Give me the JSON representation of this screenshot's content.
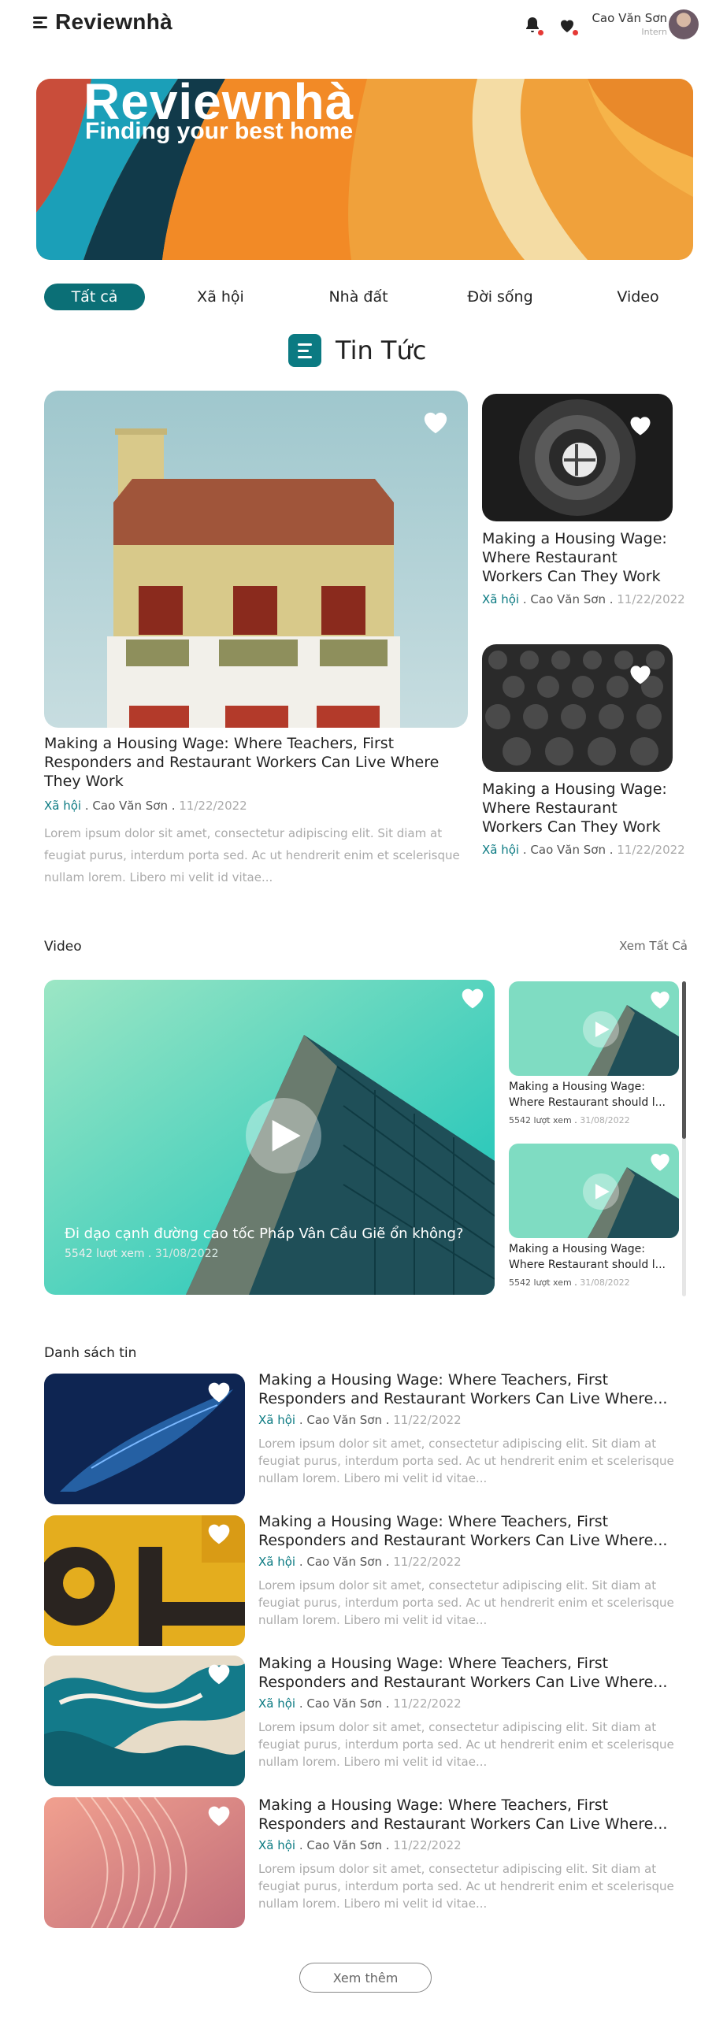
{
  "header": {
    "logo": "Reviewnhà",
    "user_name": "Cao Văn Sơn",
    "user_role": "Intern"
  },
  "banner": {
    "title": "Reviewnhà",
    "subtitle": "Finding your best home"
  },
  "tabs": [
    {
      "label": "Tất cả"
    },
    {
      "label": "Xã hội"
    },
    {
      "label": "Nhà đất"
    },
    {
      "label": "Đời sống"
    },
    {
      "label": "Video"
    }
  ],
  "news_section": {
    "title": "Tin Tức",
    "featured": {
      "title": "Making a Housing Wage: Where Teachers, First Responders and Restaurant Workers Can Live Where They Work",
      "category": "Xã hội",
      "author": "Cao Văn Sơn",
      "date": "11/22/2022",
      "excerpt": "Lorem ipsum dolor sit amet, consectetur adipiscing elit. Sit diam at feugiat purus, interdum porta sed. Ac ut hendrerit enim et scelerisque nullam lorem. Libero mi velit id vitae..."
    },
    "side": [
      {
        "title": "Making a Housing Wage: Where Restaurant Workers Can They Work",
        "category": "Xã hội",
        "author": "Cao Văn Sơn",
        "date": "11/22/2022"
      },
      {
        "title": "Making a Housing Wage: Where Restaurant Workers Can They Work",
        "category": "Xã hội",
        "author": "Cao Văn Sơn",
        "date": "11/22/2022"
      }
    ]
  },
  "video_section": {
    "title": "Video",
    "see_all": "Xem Tất Cả",
    "main": {
      "title": "Đi dạo cạnh đường cao tốc Pháp Vân Cầu Giẽ ổn không?",
      "views": "5542 lượt xem",
      "date": "31/08/2022"
    },
    "side": [
      {
        "title": "Making a Housing Wage: Where Restaurant should l...",
        "views": "5542 lượt xem",
        "date": "31/08/2022"
      },
      {
        "title": "Making a Housing Wage: Where Restaurant should l...",
        "views": "5542 lượt xem",
        "date": "31/08/2022"
      }
    ]
  },
  "list_section": {
    "title": "Danh sách tin",
    "items": [
      {
        "title": "Making a Housing Wage: Where Teachers, First Responders and Restaurant Workers Can Live Where...",
        "category": "Xã hội",
        "author": "Cao Văn Sơn",
        "date": "11/22/2022",
        "excerpt": "Lorem ipsum dolor sit amet, consectetur adipiscing elit. Sit diam at feugiat purus, interdum porta sed. Ac ut hendrerit enim et scelerisque nullam lorem. Libero mi velit id vitae..."
      },
      {
        "title": "Making a Housing Wage: Where Teachers, First Responders and Restaurant Workers Can Live Where...",
        "category": "Xã hội",
        "author": "Cao Văn Sơn",
        "date": "11/22/2022",
        "excerpt": "Lorem ipsum dolor sit amet, consectetur adipiscing elit. Sit diam at feugiat purus, interdum porta sed. Ac ut hendrerit enim et scelerisque nullam lorem. Libero mi velit id vitae..."
      },
      {
        "title": "Making a Housing Wage: Where Teachers, First Responders and Restaurant Workers Can Live Where...",
        "category": "Xã hội",
        "author": "Cao Văn Sơn",
        "date": "11/22/2022",
        "excerpt": "Lorem ipsum dolor sit amet, consectetur adipiscing elit. Sit diam at feugiat purus, interdum porta sed. Ac ut hendrerit enim et scelerisque nullam lorem. Libero mi velit id vitae..."
      },
      {
        "title": "Making a Housing Wage: Where Teachers, First Responders and Restaurant Workers Can Live Where...",
        "category": "Xã hội",
        "author": "Cao Văn Sơn",
        "date": "11/22/2022",
        "excerpt": "Lorem ipsum dolor sit amet, consectetur adipiscing elit. Sit diam at feugiat purus, interdum porta sed. Ac ut hendrerit enim et scelerisque nullam lorem. Libero mi velit id vitae..."
      }
    ],
    "more_button": "Xem thêm"
  },
  "colors": {
    "accent": "#0b7a82",
    "date": "#aaaaaa",
    "notification_dot": "#e53935"
  }
}
